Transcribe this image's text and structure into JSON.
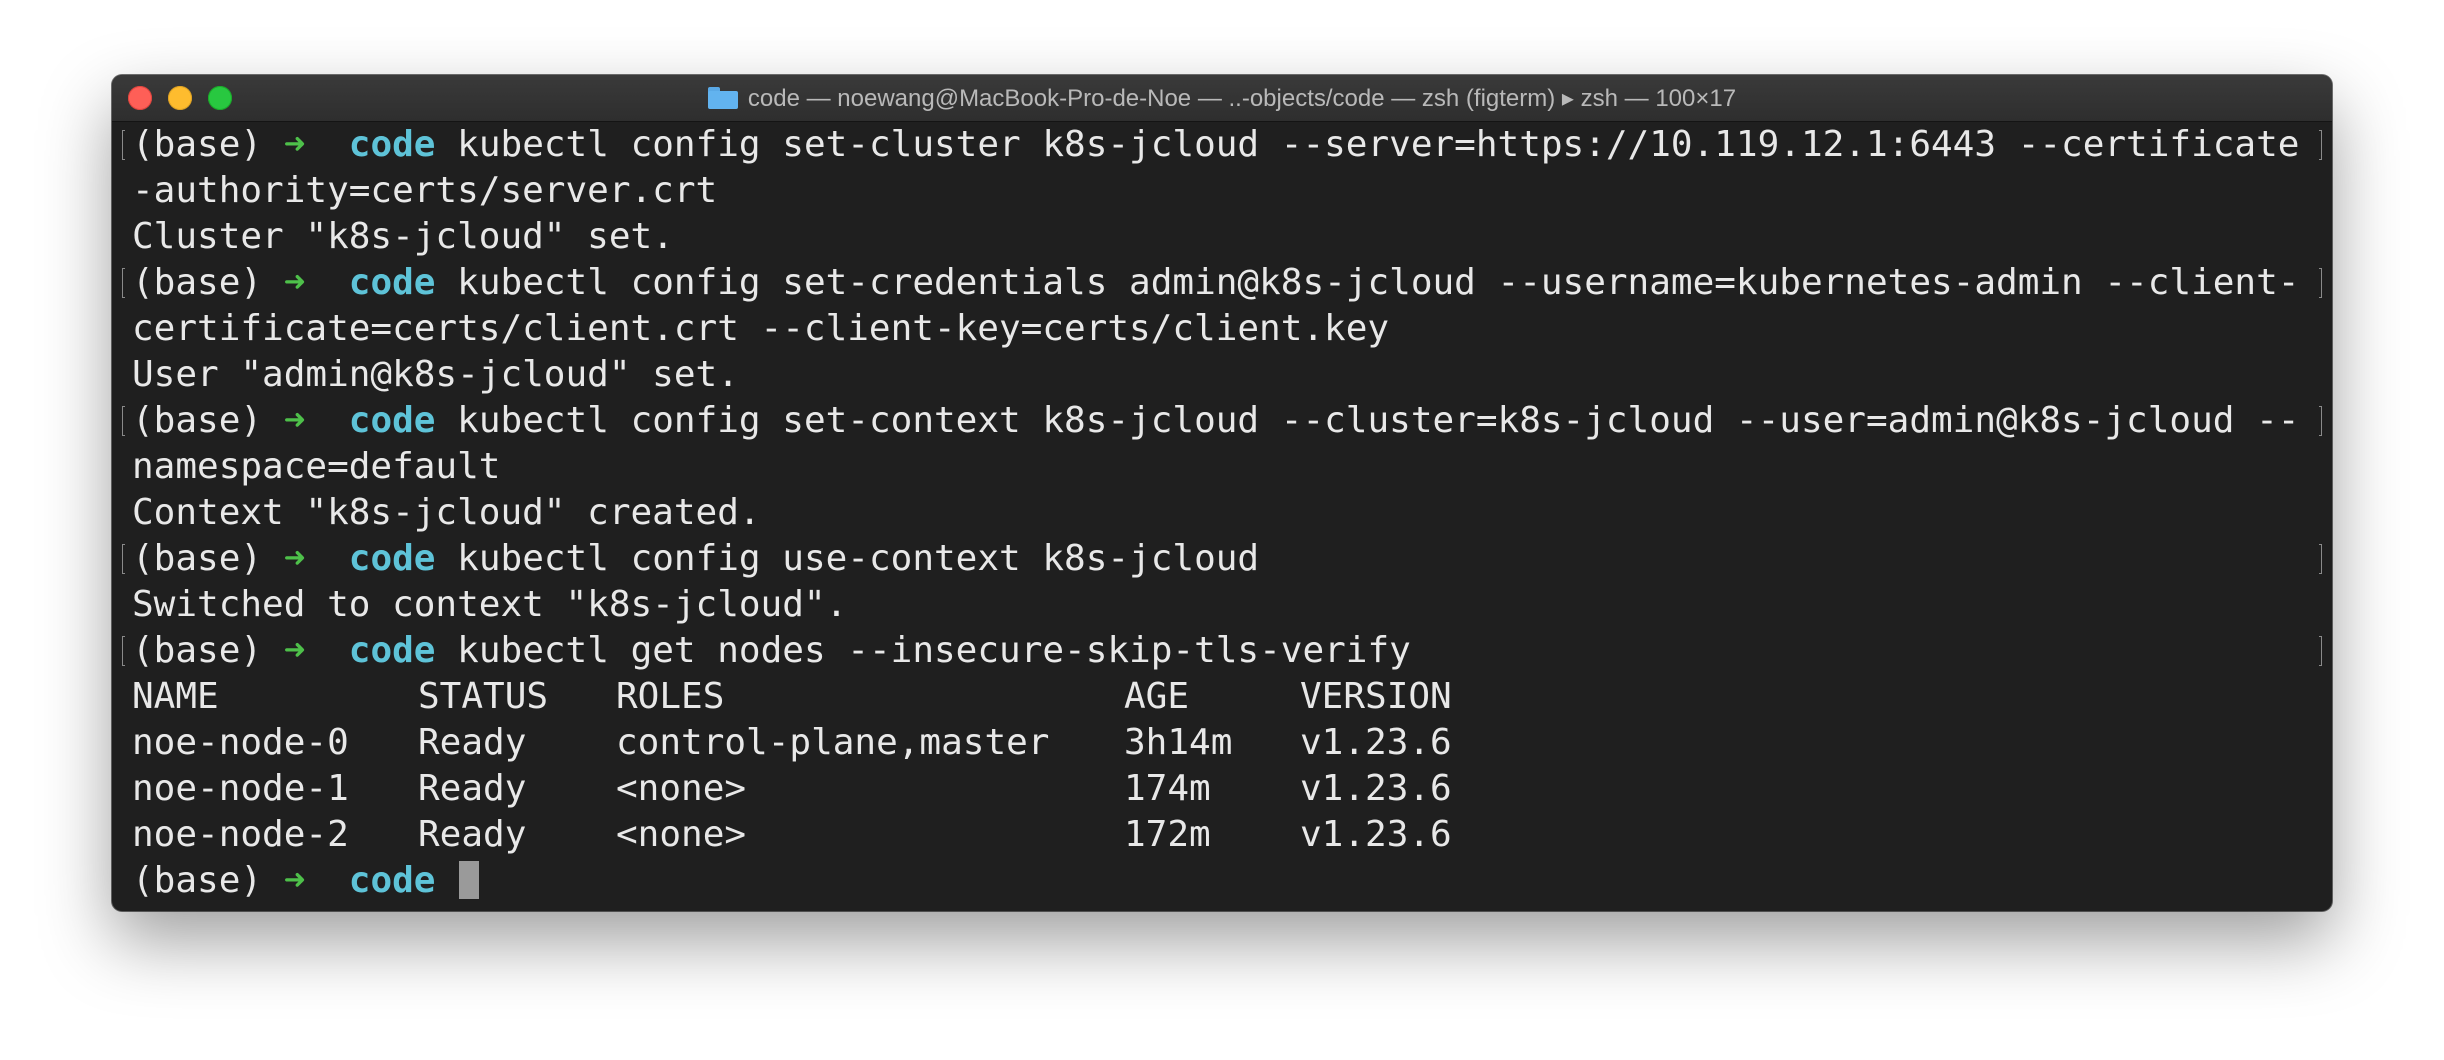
{
  "window": {
    "title": "code — noewang@MacBook-Pro-de-Noe — ..-objects/code — zsh (figterm) ▸ zsh — 100×17"
  },
  "prompt": {
    "env": "(base)",
    "arrow": "➜",
    "dir": "code"
  },
  "commands": [
    {
      "cmd": "kubectl config set-cluster k8s-jcloud --server=https://10.119.12.1:6443 --certificate",
      "cont": "-authority=certs/server.crt",
      "output": "Cluster \"k8s-jcloud\" set."
    },
    {
      "cmd": "kubectl config set-credentials admin@k8s-jcloud --username=kubernetes-admin --client-",
      "cont": "certificate=certs/client.crt --client-key=certs/client.key",
      "output": "User \"admin@k8s-jcloud\" set."
    },
    {
      "cmd": "kubectl config set-context k8s-jcloud --cluster=k8s-jcloud --user=admin@k8s-jcloud --",
      "cont": "namespace=default",
      "output": "Context \"k8s-jcloud\" created."
    },
    {
      "cmd": "kubectl config use-context k8s-jcloud",
      "output": "Switched to context \"k8s-jcloud\"."
    },
    {
      "cmd": "kubectl get nodes --insecure-skip-tls-verify"
    }
  ],
  "nodes_table": {
    "headers": [
      "NAME",
      "STATUS",
      "ROLES",
      "AGE",
      "VERSION"
    ],
    "rows": [
      [
        "noe-node-0",
        "Ready",
        "control-plane,master",
        "3h14m",
        "v1.23.6"
      ],
      [
        "noe-node-1",
        "Ready",
        "<none>",
        "174m",
        "v1.23.6"
      ],
      [
        "noe-node-2",
        "Ready",
        "<none>",
        "172m",
        "v1.23.6"
      ]
    ]
  },
  "colors": {
    "background": "#1f1f1f",
    "text": "#e8e8e8",
    "arrow": "#4ec04a",
    "dir": "#5ec3d8",
    "cursor": "#9a9a9a"
  },
  "icons": [
    "close-button",
    "minimize-button",
    "zoom-button",
    "folder-icon"
  ]
}
